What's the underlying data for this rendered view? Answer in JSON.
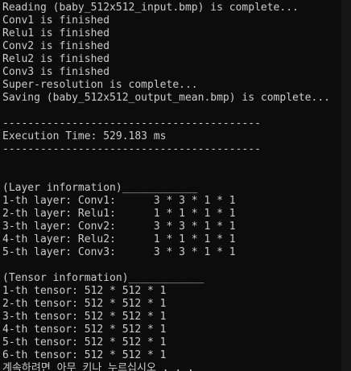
{
  "console": {
    "log_lines": [
      "Reading (baby_512x512_input.bmp) is complete...",
      "Conv1 is finished",
      "Relu1 is finished",
      "Conv2 is finished",
      "Relu2 is finished",
      "Conv3 is finished",
      "Super-resolution is complete...",
      "Saving (baby_512x512_output_mean.bmp) is complete...",
      "",
      "-----------------------------------------",
      "Execution Time: 529.183 ms",
      "-----------------------------------------",
      "",
      "",
      "(Layer information)____________",
      "1-th layer: Conv1:      3 * 3 * 1 * 1",
      "2-th layer: Relu1:      1 * 1 * 1 * 1",
      "3-th layer: Conv2:      3 * 3 * 1 * 1",
      "4-th layer: Relu2:      1 * 1 * 1 * 1",
      "5-th layer: Conv3:      3 * 3 * 1 * 1",
      "",
      "(Tensor information)____________",
      "1-th tensor: 512 * 512 * 1",
      "2-th tensor: 512 * 512 * 1",
      "3-th tensor: 512 * 512 * 1",
      "4-th tensor: 512 * 512 * 1",
      "5-th tensor: 512 * 512 * 1",
      "6-th tensor: 512 * 512 * 1",
      "계속하려면 아무 키나 누르십시오 . . ."
    ],
    "colors": {
      "background": "#0c0c0c",
      "text": "#cccccc"
    }
  }
}
